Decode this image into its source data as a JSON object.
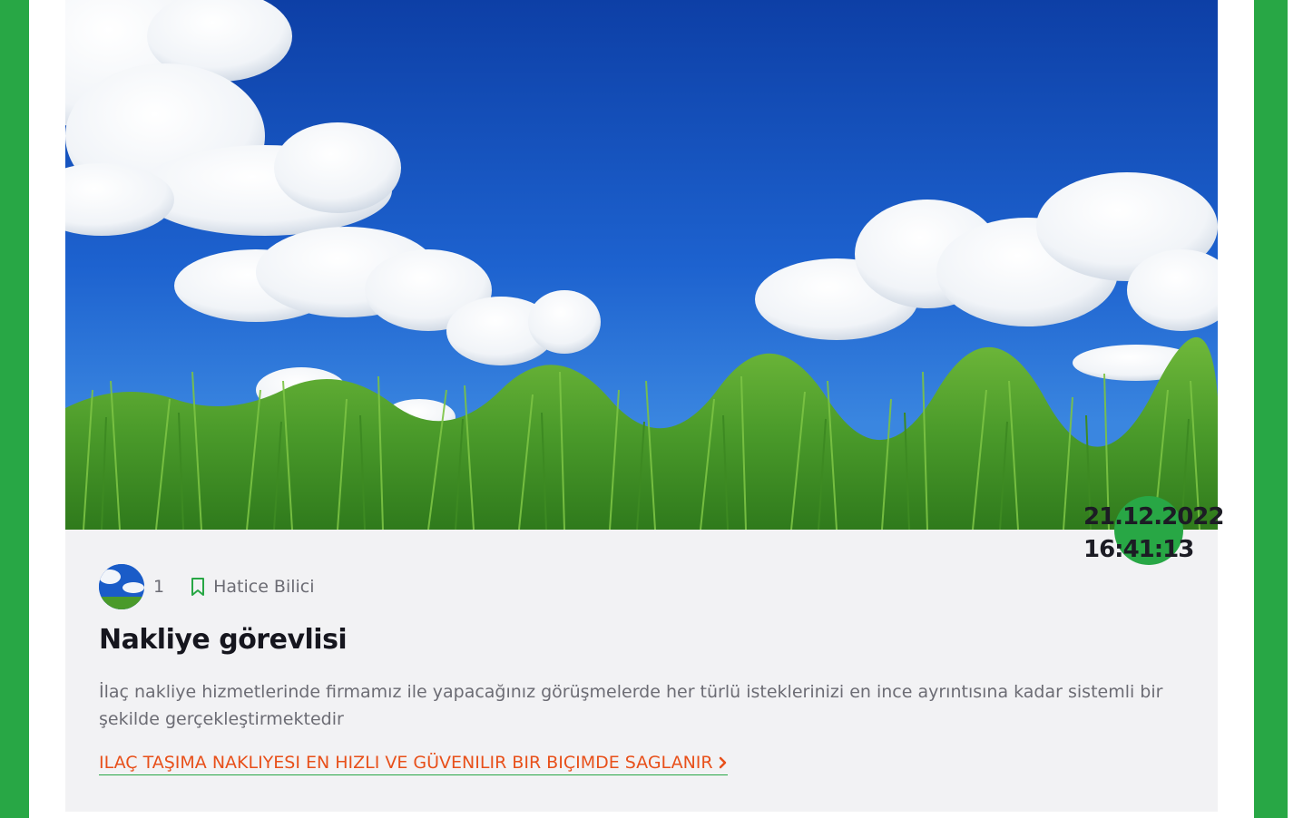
{
  "post": {
    "date": "21.12.2022",
    "time": "16:41:13",
    "comment_count": "1",
    "author": "Hatice Bilici",
    "title": "Nakliye görevlisi",
    "description": "İlaç nakliye hizmetlerinde firmamız ile yapacağınız görüşmelerde her türlü isteklerinizi en ince ayrıntısına kadar sistemli bir şekilde gerçekleştirmektedir",
    "read_more_label": "ILAÇ TAŞIMA NAKLIYESI EN HIZLI VE GÜVENILIR BIR BIÇIMDE SAGLANIR"
  },
  "icons": {
    "bookmark": "bookmark-icon",
    "chevron": "chevron-right-icon"
  },
  "colors": {
    "accent_green": "#28a745",
    "link_orange": "#e8501a",
    "card_bg": "#f2f2f4",
    "title_text": "#16161e"
  }
}
